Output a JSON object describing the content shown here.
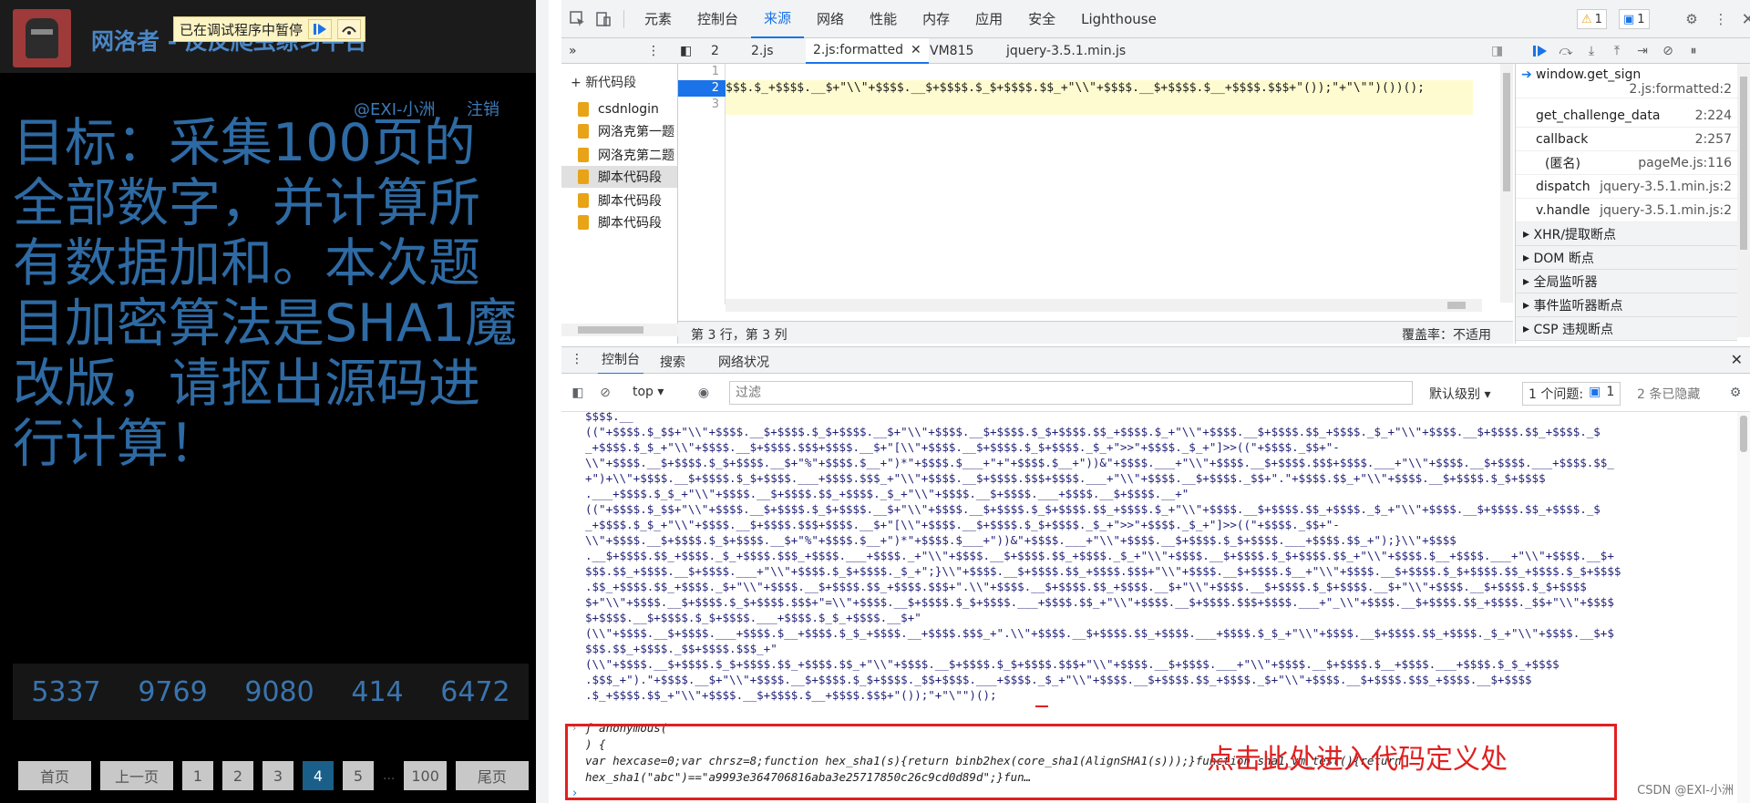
{
  "page": {
    "site_title": "网洛者 - 反反爬虫练习平台",
    "debugger_banner": "已在调试程序中暂停",
    "user": "@EXI-小洲",
    "logout": "注销",
    "task_text": "目标：采集100页的全部数字，并计算所有数据加和。本次题目加密算法是SHA1魔改版，请抠出源码进行计算！",
    "numbers": [
      "5337",
      "9769",
      "9080",
      "414",
      "6472"
    ],
    "pager": [
      "首页",
      "上一页",
      "1",
      "2",
      "3",
      "4",
      "5",
      "...",
      "100",
      "尾页"
    ],
    "current_page": "4"
  },
  "devtools": {
    "tabs": [
      "元素",
      "控制台",
      "来源",
      "网络",
      "性能",
      "内存",
      "应用",
      "安全",
      "Lighthouse"
    ],
    "active_tab": "来源",
    "warn_count": "1",
    "msg_count": "1",
    "file_tabs": [
      "2",
      "2.js",
      "2.js:formatted",
      "VM815",
      "jquery-3.5.1.min.js"
    ],
    "active_file": "2.js:formatted",
    "nav": {
      "new_snippet": "新代码段",
      "snippets": [
        "csdnlogin",
        "网洛克第一题",
        "网洛克第二题",
        "脚本代码段",
        "脚本代码段",
        "脚本代码段"
      ]
    },
    "editor": {
      "line_numbers": [
        "1",
        "2",
        "3"
      ],
      "line2_code": "$$$.$_+$$$$.__$+\"\\\\\"+$$$$.__$+$$$$.$_$+$$$$.$$_+\"\\\\\"+$$$$.__$+$$$$.$__+$$$$.$$$+\"());\"+\"\\\"\")())();",
      "status": "第 3 行，第 3 列",
      "coverage": "覆盖率：不适用"
    },
    "call_stack": [
      {
        "name": "window.get_sign",
        "loc": "2.js:formatted:2"
      },
      {
        "name": "get_challenge_data",
        "loc": "2:224"
      },
      {
        "name": "callback",
        "loc": "2:257"
      },
      {
        "name": "(匿名)",
        "loc": "pageMe.js:116"
      },
      {
        "name": "dispatch",
        "loc": "jquery-3.5.1.min.js:2"
      },
      {
        "name": "v.handle",
        "loc": "jquery-3.5.1.min.js:2"
      }
    ],
    "sections": [
      "XHR/提取断点",
      "DOM 断点",
      "全局监听器",
      "事件监听器断点",
      "CSP 违规断点"
    ],
    "drawer_tabs": [
      "控制台",
      "搜索",
      "网络状况"
    ],
    "console": {
      "context": "top",
      "filter_placeholder": "过滤",
      "level": "默认级别",
      "issues_label": "1 个问题:",
      "issues_count": "1",
      "hidden": "2 条已隐藏",
      "lines": [
        "$$$$.__",
        "((\"+$$$$.$_$$+\"\\\\\"+$$$$.__$+$$$$.$_$+$$$$.__$+\"\\\\\"+$$$$.__$+$$$$.$_$+$$$$.$$_+$$$$.$_+\"\\\\\"+$$$$.__$+$$$$.$$_+$$$$._$_+\"\\\\\"+$$$$.__$+$$$$.$$_+$$$$._$",
        "_+$$$$.$_$_+\"\\\\\"+$$$$.__$+$$$$.$$$+$$$$.__$+\"[\\\\\"+$$$$.__$+$$$$.$_$+$$$$._$_+\">>\"+$$$$._$_+\"]>>((\"+$$$$._$$+\"-",
        "\\\\\"+$$$$.__$+$$$$.$_$+$$$$.__$+\"%\"+$$$$.$__+\")*\"+$$$$.$___+\"+\"+$$$$.$__+\"))&\"+$$$$.___+\"\\\\\"+$$$$.__$+$$$$.$$$+$$$$.___+\"\\\\\"+$$$$.__$+$$$$.___+$$$$.$$_",
        "+\")+\\\\\"+$$$$.__$+$$$$.$_$+$$$$.___+$$$$.$$$_+\"\\\\\"+$$$$.__$+$$$$.$$$+$$$$.___+\"\\\\\"+$$$$.__$+$$$$._$$+\".\"+$$$$.$$_+\"\\\\\"+$$$$.__$+$$$$.$_$+$$$$",
        ".___+$$$$.$_$_+\"\\\\\"+$$$$.__$+$$$$.$$_+$$$$._$_+\"\\\\\"+$$$$.__$+$$$$.___+$$$$.__$+$$$$.__+\"",
        "((\"+$$$$.$_$$+\"\\\\\"+$$$$.__$+$$$$.$_$+$$$$.__$+\"\\\\\"+$$$$.__$+$$$$.$_$+$$$$.$$_+$$$$.$_+\"\\\\\"+$$$$.__$+$$$$.$$_+$$$$._$_+\"\\\\\"+$$$$.__$+$$$$.$$_+$$$$._$",
        "_+$$$$.$_$_+\"\\\\\"+$$$$.__$+$$$$.$$$+$$$$.__$+\"[\\\\\"+$$$$.__$+$$$$.$_$+$$$$._$_+\">>\"+$$$$._$_+\"]>>((\"+$$$$._$$+\"-",
        "\\\\\"+$$$$.__$+$$$$.$_$+$$$$.__$+\"%\"+$$$$.$__+\")*\"+$$$$.$___+\"))&\"+$$$$.___+\"\\\\\"+$$$$.__$+$$$$.$_$+$$$$.___+$$$$.$$_+\");}\\\\\"+$$$$",
        ".__$+$$$$.$$_+$$$$._$_+$$$$.$$$_+$$$$.___+$$$$._+\"\\\\\"+$$$$.__$+$$$$.$$_+$$$$._$_+\"\\\\\"+$$$$.__$+$$$$.$_$+$$$$.$$_+\"\\\\\"+$$$$.$__+$$$$.___+\"\\\\\"+$$$$.__$+",
        "$$$.$$_+$$$$.__$+$$$$.___+\"\\\\\"+$$$$.$_$+$$$$._$_+\";}\\\\\"+$$$$.__$+$$$$.$$_+$$$$.$$$+\"\\\\\"+$$$$.__$+$$$$.$__+\"\\\\\"+$$$$.__$+$$$$.$_$+$$$$.$$_+$$$$.$_$+$$$$",
        ".$$_+$$$$.$$_+$$$$._$+\"\\\\\"+$$$$.__$+$$$$.$$_+$$$$.$$$+\".\\\\\"+$$$$.__$+$$$$.$$_+$$$$.__$+\"\\\\\"+$$$$.__$+$$$$.$_$+$$$$.__$+\"\\\\\"+$$$$.__$+$$$$.$_$+$$$$",
        "$+\"\\\\\"+$$$$.__$+$$$$.$_$+$$$$.$$$+\"=\\\\\"+$$$$.__$+$$$$.$_$+$$$$.___+$$$$.$$_+\"\\\\\"+$$$$.__$+$$$$.$$$+$$$$.___+\"_\\\\\"+$$$$.__$+$$$$.$$_+$$$$._$$+\"\\\\\"+$$$$",
        "$+$$$$.__$+$$$$.$_$+$$$$.___+$$$$.$_$_+$$$$.__$+\"",
        "(\\\\\"+$$$$.__$+$$$$.___+$$$$.$__+$$$$.$_$_+$$$$.__+$$$$.$$$_+\".\\\\\"+$$$$.__$+$$$$.$$_+$$$$.___+$$$$.$_$_+\"\\\\\"+$$$$.__$+$$$$.$$_+$$$$._$_+\"\\\\\"+$$$$.__$+$",
        "$$$.$$_+$$$$._$$+$$$$.$$$_+\"",
        "(\\\\\"+$$$$.__$+$$$$.$_$+$$$$.$$_+$$$$.$$_+\"\\\\\"+$$$$.__$+$$$$.$_$+$$$$.$$$+\"\\\\\"+$$$$.__$+$$$$.___+\"\\\\\"+$$$$.__$+$$$$.$__+$$$$.___+$$$$.$_$_+$$$$",
        ".$$$_+\").\"+$$$$.__$+\"\\\\\"+$$$$.__$+$$$$.$_$+$$$$._$$+$$$$.___+$$$$._$_+\"\\\\\"+$$$$.__$+$$$$.$$_+$$$$._$+\"\\\\\"+$$$$.__$+$$$$.$$$_+$$$$.__$+$$$$",
        ".$_+$$$$.$$_+\"\\\\\"+$$$$.__$+$$$$.$__+$$$$.$$$+\"());\"+\"\\\"\")();"
      ],
      "fn_header": "ƒ anonymous(",
      "fn_line2": ") {",
      "fn_line3": "var hexcase=0;var chrsz=8;function hex_sha1(s){return binb2hex(core_sha1(AlignSHA1(s)));}function sha1_vm_test(){return",
      "fn_line4": "hex_sha1(\"abc\")==\"a9993e364706816aba3e25717850c26c9cd0d89d\";}fun…",
      "annotation": "点击此处进入代码定义处"
    },
    "watermark": "CSDN @EXI-小洲"
  }
}
